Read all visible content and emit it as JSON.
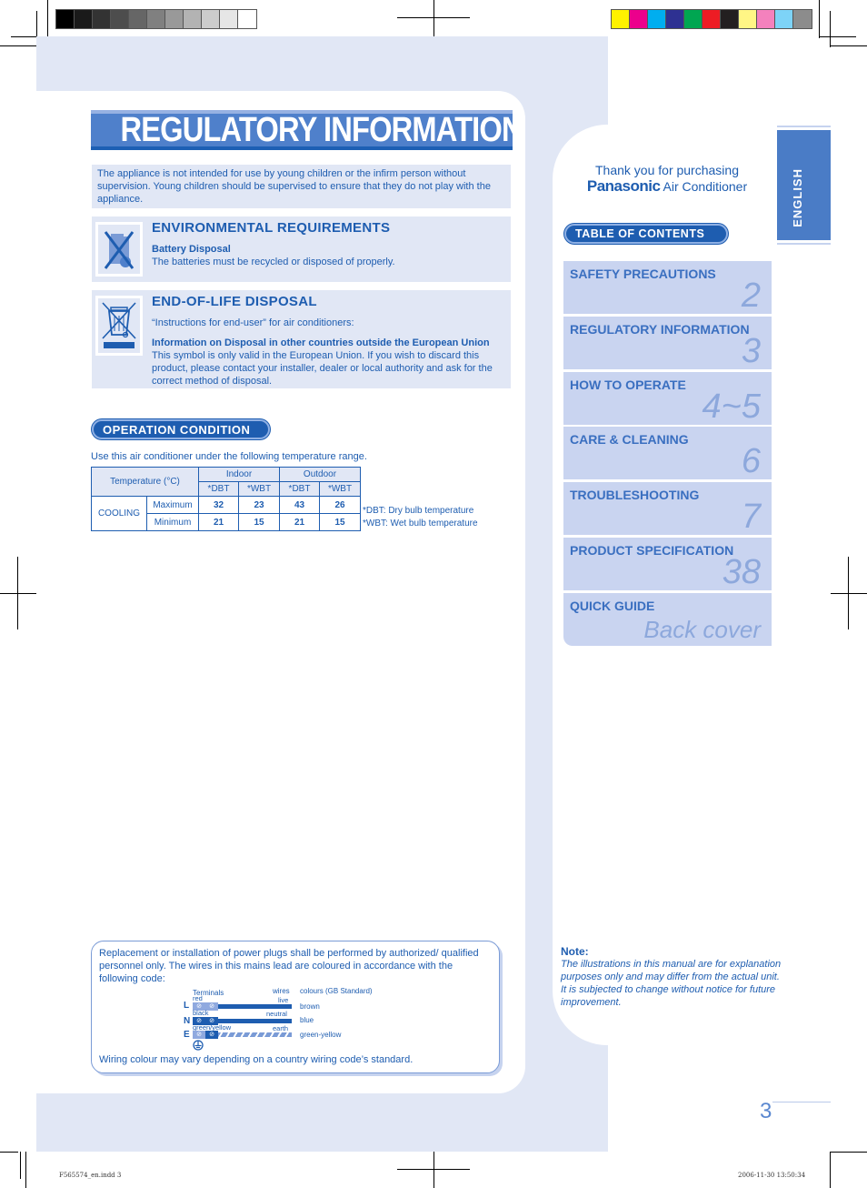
{
  "printer_marks": {
    "grayscale_swatches": [
      "#000000",
      "#1a1a1a",
      "#333333",
      "#4d4d4d",
      "#666666",
      "#808080",
      "#999999",
      "#b3b3b3",
      "#cccccc",
      "#e6e6e6",
      "#ffffff"
    ],
    "color_swatches": [
      "#fff200",
      "#ec008c",
      "#00aeef",
      "#2e3192",
      "#00a651",
      "#ed1c24",
      "#231f20",
      "#fff685",
      "#f481bd",
      "#7dd3f7",
      "#8c8c8c"
    ],
    "slug_left": "F565574_en.indd   3",
    "slug_right": "2006-11-30   13:50:34"
  },
  "colors": {
    "brand_blue": "#1e5db0",
    "banner_blue": "#4f80cb",
    "panel_tint": "#e1e7f5",
    "toc_tint": "#c9d4f0"
  },
  "title": "REGULATORY INFORMATION",
  "intro": "The appliance is not intended for use by young children or the infirm person without supervision. Young children should be supervised to ensure that they do not play with the appliance.",
  "environmental": {
    "heading": "ENVIRONMENTAL REQUIREMENTS",
    "icon": "crossed-battery-bin-icon",
    "subheading": "Battery Disposal",
    "body": "The batteries must be recycled or disposed of properly."
  },
  "end_of_life": {
    "heading": "END-OF-LIFE DISPOSAL",
    "icon": "crossed-wheelie-bin-icon",
    "lead": "“Instructions for end-user” for air conditioners:",
    "subheading": "Information on Disposal in other countries outside the European Union",
    "body": "This symbol is only valid in the European Union. If you wish to discard this product, please contact your installer, dealer or local authority and ask for the correct method of disposal."
  },
  "operation": {
    "pill": "OPERATION CONDITION",
    "lead": "Use this air conditioner under the following temperature range.",
    "table": {
      "corner": "Temperature (°C)",
      "groups": [
        "Indoor",
        "Outdoor"
      ],
      "subheads": [
        "*DBT",
        "*WBT",
        "*DBT",
        "*WBT"
      ],
      "mode": "COOLING",
      "rows": [
        {
          "label": "Maximum",
          "values": [
            "32",
            "23",
            "43",
            "26"
          ]
        },
        {
          "label": "Minimum",
          "values": [
            "21",
            "15",
            "21",
            "15"
          ]
        }
      ]
    },
    "notes": [
      "*DBT: Dry bulb temperature",
      "*WBT: Wet bulb temperature"
    ]
  },
  "wiring": {
    "intro": "Replacement or installation of power plugs shall be performed by authorized/ qualified personnel only. The wires in this mains lead are coloured in accordance with the following code:",
    "col_terminals": "Terminals",
    "col_wires": "wires",
    "col_colours": "colours (GB Standard)",
    "rows": [
      {
        "letter": "L",
        "terminal": "red",
        "wire": "live",
        "colour": "brown"
      },
      {
        "letter": "N",
        "terminal": "black",
        "wire": "neutral",
        "colour": "blue"
      },
      {
        "letter": "E",
        "terminal": "green/yellow",
        "wire": "earth",
        "colour": "green-yellow"
      }
    ],
    "earth_icon": "earth-ground-icon",
    "footer": "Wiring colour may vary depending on a country wiring code’s standard."
  },
  "sidebar": {
    "thanks_line1": "Thank you for purchasing",
    "brand": "Panasonic",
    "product": "Air Conditioner",
    "language_tab": "ENGLISH",
    "toc_pill": "TABLE OF CONTENTS",
    "toc": [
      {
        "label": "SAFETY PRECAUTIONS",
        "page": "2"
      },
      {
        "label": "REGULATORY INFORMATION",
        "page": "3"
      },
      {
        "label": "HOW TO OPERATE",
        "page": "4~5"
      },
      {
        "label": "CARE & CLEANING",
        "page": "6"
      },
      {
        "label": "TROUBLESHOOTING",
        "page": "7"
      },
      {
        "label": "PRODUCT SPECIFICATION",
        "page": "38"
      },
      {
        "label": "QUICK GUIDE",
        "page": "Back cover"
      }
    ],
    "note_title": "Note:",
    "note_body": "The illustrations in this manual are for explanation purposes only and may differ from the actual unit. It is subjected to change without notice for future improvement."
  },
  "page_number": "3"
}
